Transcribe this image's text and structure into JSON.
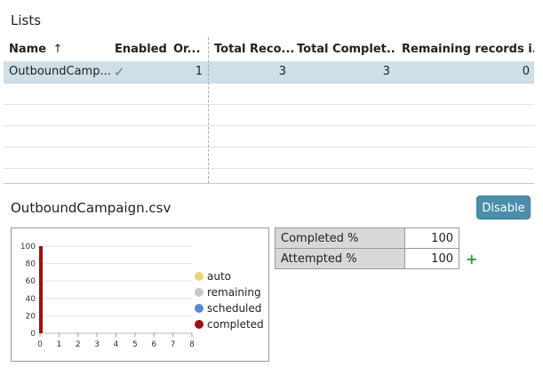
{
  "lists_title": "Lists",
  "columns": {
    "name": "Name",
    "sort_arrow": "↑",
    "enabled": "Enabled",
    "order": "Or...",
    "total_records": "Total Reco...",
    "total_completed": "Total Complet...",
    "remaining_records": "Remaining records i..."
  },
  "rows": [
    {
      "name": "OutboundCamp...",
      "enabled_icon": "✓",
      "order": "1",
      "total_records": "3",
      "total_completed": "3",
      "remaining": "0"
    }
  ],
  "detail": {
    "title": "OutboundCampaign.csv",
    "disable_button": "Disable",
    "stats": [
      {
        "label": "Completed %",
        "value": "100"
      },
      {
        "label": "Attempted %",
        "value": "100"
      }
    ],
    "add_icon": "+"
  },
  "chart_data": {
    "type": "bar",
    "x_ticks": [
      "0",
      "1",
      "2",
      "3",
      "4",
      "5",
      "6",
      "7",
      "8"
    ],
    "y_ticks": [
      "0",
      "20",
      "40",
      "60",
      "80",
      "100"
    ],
    "ylim": [
      0,
      100
    ],
    "xlim": [
      0,
      8
    ],
    "grid": true,
    "legend_position": "right",
    "series": [
      {
        "name": "auto",
        "color": "#e8d67c",
        "points": []
      },
      {
        "name": "remaining",
        "color": "#c8c8c8",
        "points": []
      },
      {
        "name": "scheduled",
        "color": "#5a86d8",
        "points": []
      },
      {
        "name": "completed",
        "color": "#a01010",
        "points": [
          {
            "x": 0,
            "y": 100
          }
        ]
      }
    ]
  }
}
